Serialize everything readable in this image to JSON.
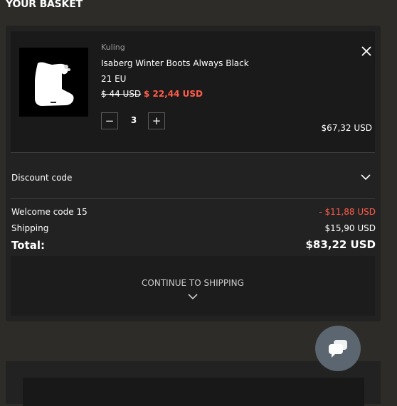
{
  "header": {
    "title": "YOUR BASKET"
  },
  "item": {
    "brand": "Kuling",
    "name": "Isaberg Winter Boots Always Black",
    "size": "21 EU",
    "price_old": "$ 44 USD",
    "price_new": "$ 22,44 USD",
    "quantity": "3",
    "quantity_minus": "−",
    "quantity_plus": "+",
    "line_total": "$67,32 USD"
  },
  "discount": {
    "label": "Discount code"
  },
  "summary": {
    "welcome_label": "Welcome code 15",
    "welcome_value": "- $11,88 USD",
    "shipping_label": "Shipping",
    "shipping_value": "$15,90 USD",
    "total_label": "Total:",
    "total_value": "$83,22 USD"
  },
  "cta": {
    "label": "CONTINUE TO SHIPPING"
  },
  "colors": {
    "background": "#2d2c28",
    "card": "#222222",
    "accent_sale": "#ff5c4a",
    "chat_button": "#5b6670"
  },
  "icons": {
    "close": "close-icon",
    "discount_toggle": "chevron-down-icon",
    "chat": "chat-icon"
  }
}
